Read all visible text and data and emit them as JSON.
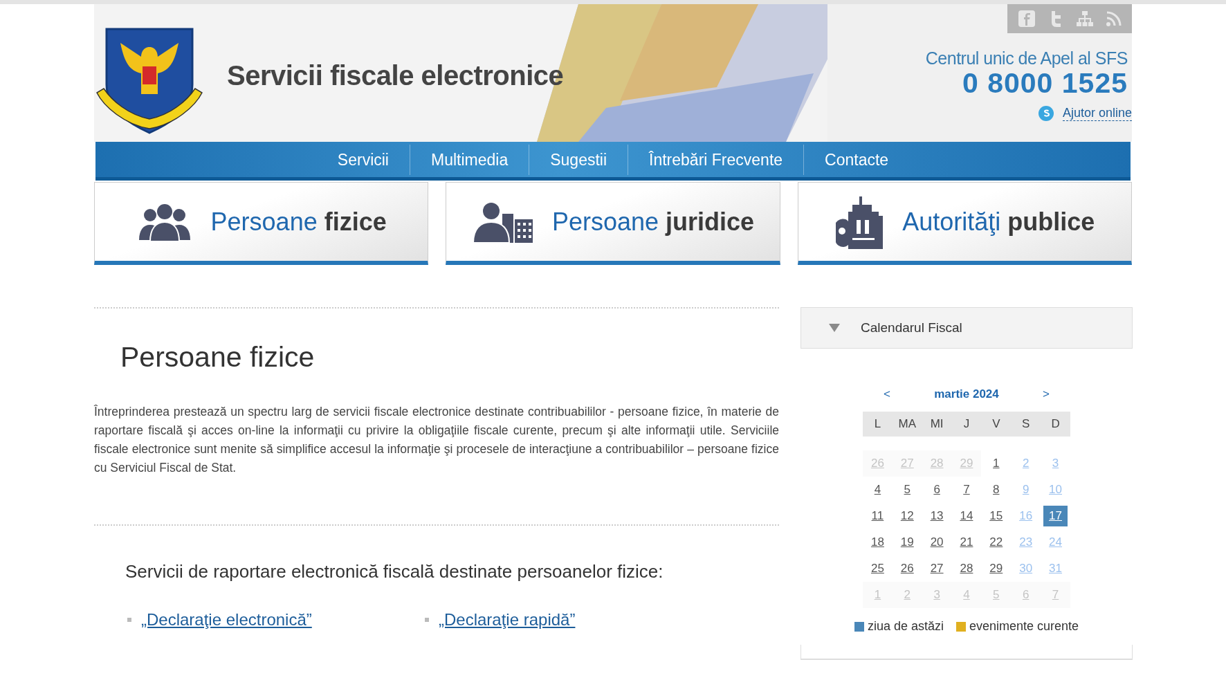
{
  "header": {
    "title": "Servicii fiscale electronice",
    "hotline_label": "Centrul unic de Apel al SFS",
    "phone": "0 8000 1525",
    "help_link": "Ajutor online"
  },
  "nav": [
    {
      "label": "Servicii"
    },
    {
      "label": "Multimedia"
    },
    {
      "label": "Sugestii"
    },
    {
      "label": "Întrebări Frecvente"
    },
    {
      "label": "Contacte"
    }
  ],
  "categories": [
    {
      "kind": "people",
      "text": "Persoane **fizice**"
    },
    {
      "kind": "business",
      "text": "Persoane **juridice**"
    },
    {
      "kind": "authority",
      "text": "Autorităţi **publice**"
    }
  ],
  "article": {
    "title": "Persoane fizice",
    "paragraph": "Întreprinderea prestează un spectru larg de servicii fiscale electronice destinate contribuabililor - persoane fizice, în materie de raportare fiscală şi acces on-line la informaţii cu privire la obligaţiile fiscale curente, precum şi alte informaţii utile. Serviciile fiscale electronice sunt menite să simplifice accesul la informaţie şi procesele de interacţiune a contribuabililor – persoane fizice cu Serviciul Fiscal de Stat.",
    "subtitle": "Servicii de raportare electronică fiscală destinate persoanelor fizice:",
    "links": [
      "„Declaraţie electronică”",
      "„Declaraţie rapidă”"
    ]
  },
  "calendar": {
    "title": "Calendarul Fiscal",
    "expanded": true,
    "prev": "<",
    "month": "martie 2024",
    "next": ">",
    "weekdays": [
      "L",
      "MA",
      "MI",
      "J",
      "V",
      "S",
      "D"
    ],
    "weeks": [
      [
        {
          "label": "26",
          "kind": "other",
          "selected": false
        },
        {
          "label": "27",
          "kind": "other",
          "selected": false
        },
        {
          "label": "28",
          "kind": "other",
          "selected": false
        },
        {
          "label": "29",
          "kind": "other",
          "selected": false
        },
        {
          "label": "1",
          "kind": "weekday",
          "selected": false
        },
        {
          "label": "2",
          "kind": "weekend",
          "selected": false
        },
        {
          "label": "3",
          "kind": "weekend",
          "selected": false
        }
      ],
      [
        {
          "label": "4",
          "kind": "weekday",
          "selected": false
        },
        {
          "label": "5",
          "kind": "weekday",
          "selected": false
        },
        {
          "label": "6",
          "kind": "weekday",
          "selected": false
        },
        {
          "label": "7",
          "kind": "weekday",
          "selected": false
        },
        {
          "label": "8",
          "kind": "weekday",
          "selected": false
        },
        {
          "label": "9",
          "kind": "weekend",
          "selected": false
        },
        {
          "label": "10",
          "kind": "weekend",
          "selected": false
        }
      ],
      [
        {
          "label": "11",
          "kind": "weekday",
          "selected": false
        },
        {
          "label": "12",
          "kind": "weekday",
          "selected": false
        },
        {
          "label": "13",
          "kind": "weekday",
          "selected": false
        },
        {
          "label": "14",
          "kind": "weekday",
          "selected": false
        },
        {
          "label": "15",
          "kind": "weekday",
          "selected": false
        },
        {
          "label": "16",
          "kind": "weekend",
          "selected": false
        },
        {
          "label": "17",
          "kind": "weekend",
          "selected": true
        }
      ],
      [
        {
          "label": "18",
          "kind": "weekday",
          "selected": false
        },
        {
          "label": "19",
          "kind": "weekday",
          "selected": false
        },
        {
          "label": "20",
          "kind": "weekday",
          "selected": false
        },
        {
          "label": "21",
          "kind": "weekday",
          "selected": false
        },
        {
          "label": "22",
          "kind": "weekday",
          "selected": false
        },
        {
          "label": "23",
          "kind": "weekend",
          "selected": false
        },
        {
          "label": "24",
          "kind": "weekend",
          "selected": false
        }
      ],
      [
        {
          "label": "25",
          "kind": "weekday",
          "selected": false
        },
        {
          "label": "26",
          "kind": "weekday",
          "selected": false
        },
        {
          "label": "27",
          "kind": "weekday",
          "selected": false
        },
        {
          "label": "28",
          "kind": "weekday",
          "selected": false
        },
        {
          "label": "29",
          "kind": "weekday",
          "selected": false
        },
        {
          "label": "30",
          "kind": "weekend",
          "selected": false
        },
        {
          "label": "31",
          "kind": "weekend",
          "selected": false
        }
      ],
      [
        {
          "label": "1",
          "kind": "other",
          "selected": false
        },
        {
          "label": "2",
          "kind": "other",
          "selected": false
        },
        {
          "label": "3",
          "kind": "other",
          "selected": false
        },
        {
          "label": "4",
          "kind": "other",
          "selected": false
        },
        {
          "label": "5",
          "kind": "other",
          "selected": false
        },
        {
          "label": "6",
          "kind": "other",
          "selected": false
        },
        {
          "label": "7",
          "kind": "other",
          "selected": false
        }
      ]
    ],
    "legend": [
      {
        "label": "ziua de astăzi",
        "color": "#4a87b8"
      },
      {
        "label": "evenimente curente",
        "color": "#e0b020"
      }
    ]
  }
}
